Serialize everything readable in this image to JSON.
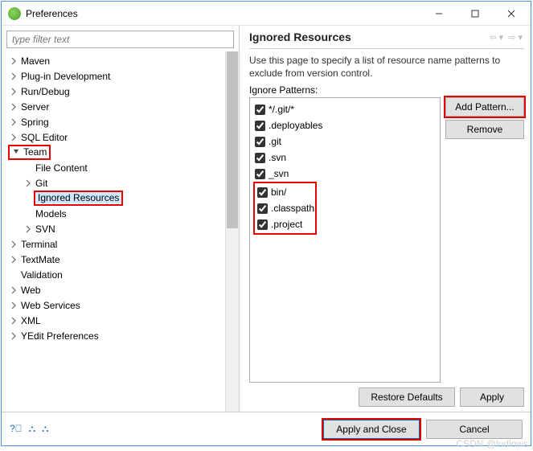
{
  "window": {
    "title": "Preferences"
  },
  "filter": {
    "placeholder": "type filter text"
  },
  "tree": {
    "items": [
      {
        "label": "Maven",
        "level": 0,
        "expandable": true,
        "expanded": false
      },
      {
        "label": "Plug-in Development",
        "level": 0,
        "expandable": true,
        "expanded": false
      },
      {
        "label": "Run/Debug",
        "level": 0,
        "expandable": true,
        "expanded": false
      },
      {
        "label": "Server",
        "level": 0,
        "expandable": true,
        "expanded": false
      },
      {
        "label": "Spring",
        "level": 0,
        "expandable": true,
        "expanded": false
      },
      {
        "label": "SQL Editor",
        "level": 0,
        "expandable": true,
        "expanded": false
      },
      {
        "label": "Team",
        "level": 0,
        "expandable": true,
        "expanded": true,
        "highlight": true
      },
      {
        "label": "File Content",
        "level": 1,
        "expandable": false
      },
      {
        "label": "Git",
        "level": 1,
        "expandable": true,
        "expanded": false
      },
      {
        "label": "Ignored Resources",
        "level": 1,
        "expandable": false,
        "selected": true,
        "highlight": true
      },
      {
        "label": "Models",
        "level": 1,
        "expandable": false
      },
      {
        "label": "SVN",
        "level": 1,
        "expandable": true,
        "expanded": false
      },
      {
        "label": "Terminal",
        "level": 0,
        "expandable": true,
        "expanded": false
      },
      {
        "label": "TextMate",
        "level": 0,
        "expandable": true,
        "expanded": false
      },
      {
        "label": "Validation",
        "level": 0,
        "expandable": false
      },
      {
        "label": "Web",
        "level": 0,
        "expandable": true,
        "expanded": false
      },
      {
        "label": "Web Services",
        "level": 0,
        "expandable": true,
        "expanded": false
      },
      {
        "label": "XML",
        "level": 0,
        "expandable": true,
        "expanded": false
      },
      {
        "label": "YEdit Preferences",
        "level": 0,
        "expandable": true,
        "expanded": false
      }
    ]
  },
  "panel": {
    "title": "Ignored Resources",
    "description": "Use this page to specify a list of resource name patterns to exclude from version control.",
    "list_label": "Ignore Patterns:",
    "patterns": [
      {
        "label": "*/.git/*",
        "checked": true
      },
      {
        "label": ".deployables",
        "checked": true
      },
      {
        "label": ".git",
        "checked": true
      },
      {
        "label": ".svn",
        "checked": true
      },
      {
        "label": "_svn",
        "checked": true
      },
      {
        "label": "bin/",
        "checked": true,
        "group": true
      },
      {
        "label": ".classpath",
        "checked": true,
        "group": true
      },
      {
        "label": ".project",
        "checked": true,
        "group": true
      }
    ],
    "buttons": {
      "add": "Add Pattern...",
      "remove": "Remove",
      "restore": "Restore Defaults",
      "apply": "Apply"
    }
  },
  "footer": {
    "apply_close": "Apply and Close",
    "cancel": "Cancel",
    "help_icon": "help-icon",
    "import_icon": "import-icon",
    "export_icon": "export-icon"
  },
  "watermark": "CSDN @ludlows",
  "colors": {
    "highlight": "#e60000",
    "accent": "#0a64a4"
  }
}
